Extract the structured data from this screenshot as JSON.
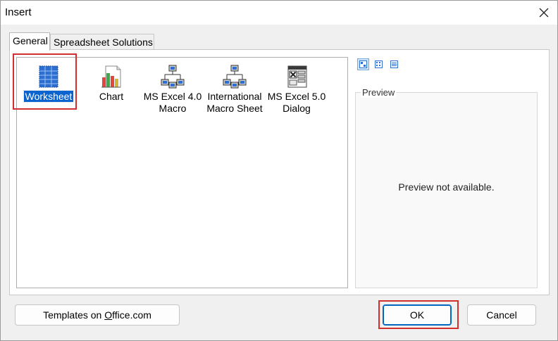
{
  "window": {
    "title": "Insert"
  },
  "tabs": [
    {
      "label": "General",
      "selected": true
    },
    {
      "label": "Spreadsheet Solutions",
      "selected": false
    }
  ],
  "items": [
    {
      "label": "Worksheet",
      "icon": "worksheet-icon",
      "selected": true
    },
    {
      "label": "Chart",
      "icon": "chart-icon",
      "selected": false
    },
    {
      "label": "MS Excel 4.0 Macro",
      "icon": "macro-icon",
      "selected": false
    },
    {
      "label": "International Macro Sheet",
      "icon": "macro-icon",
      "selected": false
    },
    {
      "label": "MS Excel 5.0 Dialog",
      "icon": "dialog-sheet-icon",
      "selected": false
    }
  ],
  "view_buttons": [
    {
      "icon": "large-icons-view-icon",
      "active": true
    },
    {
      "icon": "list-view-icon",
      "active": false
    },
    {
      "icon": "details-view-icon",
      "active": false
    }
  ],
  "preview": {
    "label": "Preview",
    "text": "Preview not available."
  },
  "buttons": {
    "templates": {
      "pre": "Templates on ",
      "underlined": "O",
      "post": "ffice.com"
    },
    "ok": "OK",
    "cancel": "Cancel"
  },
  "colors": {
    "selection": "#0a64d0",
    "highlight_box": "#d32f2f",
    "default_button_border": "#0067c0"
  }
}
